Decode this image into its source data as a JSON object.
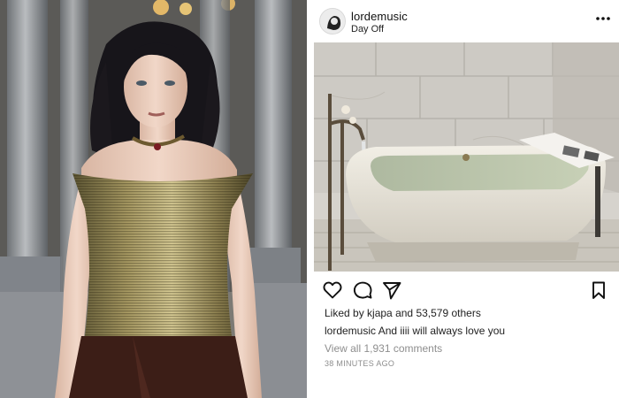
{
  "post": {
    "username": "lordemusic",
    "location": "Day Off",
    "more_icon": "more-options-icon",
    "actions": {
      "like_icon": "heart-icon",
      "comment_icon": "comment-icon",
      "share_icon": "send-icon",
      "save_icon": "bookmark-icon"
    },
    "likes": {
      "prefix": "Liked by",
      "user": "kjapa",
      "connector": "and",
      "count": "53,579 others"
    },
    "caption": {
      "user": "lordemusic",
      "text": "And iiii will always love you"
    },
    "view_comments": "View all 1,931 comments",
    "timestamp": "38 MINUTES AGO"
  },
  "colors": {
    "text": "#222222",
    "muted": "#8e8e8e",
    "background": "#ffffff"
  }
}
